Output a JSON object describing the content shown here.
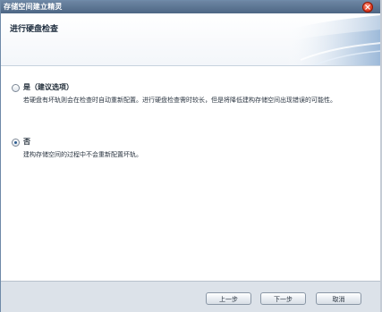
{
  "window": {
    "title": "存储空间建立精灵",
    "close_label": "×"
  },
  "header": {
    "title": "进行硬盘检查"
  },
  "options": [
    {
      "label": "是（建议选项）",
      "description": "若硬盘有坏轨则会在检查时自动重新配置。进行硬盘检查需时较长，但是将降低建构存储空间出现错误的可能性。",
      "checked": false
    },
    {
      "label": "否",
      "description": "建构存储空间的过程中不会重新配置坏轨。",
      "checked": true
    }
  ],
  "footer": {
    "prev_label": "上一步",
    "next_label": "下一步",
    "cancel_label": "取消"
  },
  "colors": {
    "titlebar": "#5f7897",
    "footer": "#dce2e9",
    "accent": "#2b5b8f"
  }
}
